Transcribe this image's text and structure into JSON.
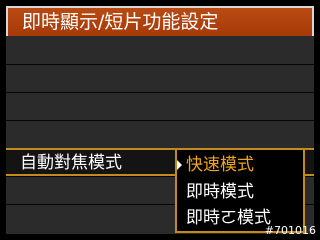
{
  "header": {
    "title": "即時顯示/短片功能設定"
  },
  "menu": {
    "item_label": "自動對焦模式"
  },
  "dropdown": {
    "options": [
      {
        "label": "快速模式",
        "selected": true
      },
      {
        "label": "即時模式",
        "selected": false
      },
      {
        "label": "即時ㄛ模式",
        "selected": false
      }
    ]
  },
  "watermark": "#701016",
  "colors": {
    "title_bg": "#b94a12",
    "accent": "#c58a1c",
    "selected_text": "#f0a31a",
    "list_bg": "#2b2b2b"
  }
}
